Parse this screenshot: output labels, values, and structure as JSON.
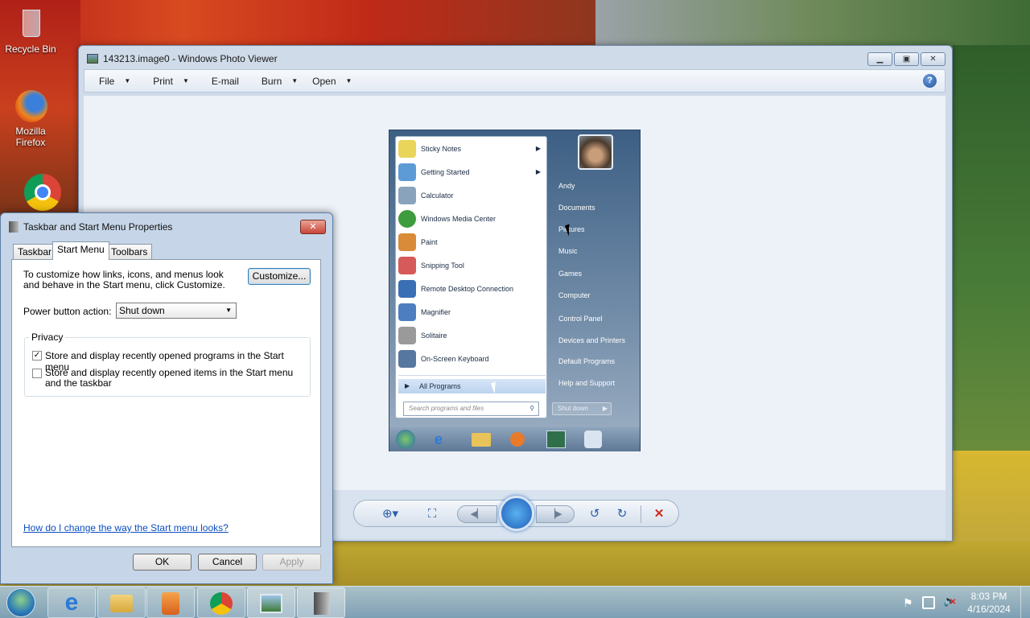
{
  "desktop": {
    "icons": [
      {
        "label": "Recycle Bin",
        "icon": "recycle-bin-icon"
      },
      {
        "label": "Mozilla Firefox",
        "line1": "Mozilla",
        "line2": "Firefox",
        "icon": "firefox-icon"
      },
      {
        "label": "",
        "icon": "chrome-icon"
      }
    ]
  },
  "photo_viewer": {
    "title": "143213.image0 - Windows Photo Viewer",
    "menu": [
      {
        "label": "File",
        "has_arrow": true
      },
      {
        "label": "Print",
        "has_arrow": true
      },
      {
        "label": "E-mail",
        "has_arrow": false
      },
      {
        "label": "Burn",
        "has_arrow": true
      },
      {
        "label": "Open",
        "has_arrow": true
      }
    ],
    "help_icon": "help-icon",
    "window_buttons": [
      "minimize",
      "maximize",
      "close"
    ],
    "toolbar": [
      "zoom-icon",
      "actual-size-icon",
      "previous-icon",
      "slideshow-icon",
      "next-icon",
      "rotate-left-icon",
      "rotate-right-icon",
      "delete-icon"
    ]
  },
  "start_menu_image": {
    "programs": [
      {
        "label": "Sticky Notes",
        "submenu": true,
        "color": "#e9d55a"
      },
      {
        "label": "Getting Started",
        "submenu": true,
        "color": "#5c9bd6"
      },
      {
        "label": "Calculator",
        "submenu": false,
        "color": "#8aa3bd"
      },
      {
        "label": "Windows Media Center",
        "submenu": false,
        "color": "#3e9b3e"
      },
      {
        "label": "Paint",
        "submenu": false,
        "color": "#d98b3a"
      },
      {
        "label": "Snipping Tool",
        "submenu": false,
        "color": "#d65a5a"
      },
      {
        "label": "Remote Desktop Connection",
        "submenu": false,
        "color": "#3a6fb5"
      },
      {
        "label": "Magnifier",
        "submenu": false,
        "color": "#4d7fc0"
      },
      {
        "label": "Solitaire",
        "submenu": false,
        "color": "#9a9a9a"
      },
      {
        "label": "On-Screen Keyboard",
        "submenu": false,
        "color": "#5577a0"
      }
    ],
    "all_programs": "All Programs",
    "search_placeholder": "Search programs and files",
    "right_links": [
      "Andy",
      "Documents",
      "Pictures",
      "Music",
      "Games",
      "Computer",
      "Control Panel",
      "Devices and Printers",
      "Default Programs",
      "Help and Support"
    ],
    "shutdown": "Shut down"
  },
  "dialog": {
    "title": "Taskbar and Start Menu Properties",
    "tabs": [
      "Taskbar",
      "Start Menu",
      "Toolbars"
    ],
    "active_tab": "Start Menu",
    "description": "To customize how links, icons, and menus look and behave in the Start menu, click Customize.",
    "customize_button": "Customize...",
    "power_label": "Power button action:",
    "power_value": "Shut down",
    "privacy_group": "Privacy",
    "privacy_options": [
      {
        "label": "Store and display recently opened programs in the Start menu",
        "checked": true
      },
      {
        "label": "Store and display recently opened items in the Start menu and the taskbar",
        "checked": false
      }
    ],
    "help_link": "How do I change the way the Start menu looks?",
    "ok": "OK",
    "cancel": "Cancel",
    "apply": "Apply"
  },
  "taskbar": {
    "items": [
      "start-orb",
      "internet-explorer-icon",
      "windows-explorer-icon",
      "media-player-icon",
      "chrome-icon",
      "photo-viewer-icon",
      "taskbar-properties-icon"
    ],
    "tray_icons": [
      "action-center-flag-icon",
      "network-icon",
      "volume-muted-icon"
    ],
    "time": "8:03 PM",
    "date": "4/16/2024"
  },
  "colors": {
    "accent": "#2b5ea8",
    "link": "#0b4ec2",
    "close_red": "#c8463a"
  }
}
